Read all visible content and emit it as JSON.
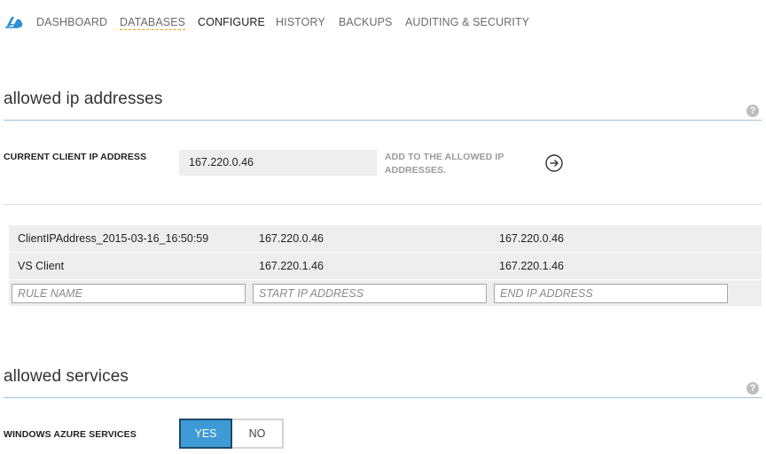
{
  "nav": {
    "logo_icon": "azure-cloud-icon",
    "tabs": [
      {
        "label": "DASHBOARD"
      },
      {
        "label": "DATABASES"
      },
      {
        "label": "CONFIGURE"
      },
      {
        "label": "HISTORY"
      },
      {
        "label": "BACKUPS"
      },
      {
        "label": "AUDITING & SECURITY"
      }
    ],
    "active_tab": "CONFIGURE"
  },
  "allowed_ip": {
    "title": "allowed ip addresses",
    "current_client_label": "CURRENT CLIENT IP ADDRESS",
    "current_client_value": "167.220.0.46",
    "add_action_label": "ADD TO THE ALLOWED IP ADDRESSES.",
    "add_icon": "circle-arrow-right-icon",
    "rules": [
      {
        "name": "ClientIPAddress_2015-03-16_16:50:59",
        "start": "167.220.0.46",
        "end": "167.220.0.46"
      },
      {
        "name": "VS Client",
        "start": "167.220.1.46",
        "end": "167.220.1.46"
      }
    ],
    "new_rule": {
      "name_placeholder": "RULE NAME",
      "start_placeholder": "START IP ADDRESS",
      "end_placeholder": "END IP ADDRESS"
    }
  },
  "allowed_services": {
    "title": "allowed services",
    "azure_label": "WINDOWS AZURE SERVICES",
    "yes_label": "YES",
    "no_label": "NO",
    "selected": "YES",
    "accent_color": "#3e9bd5"
  },
  "help_icon": "question-mark-icon",
  "colors": {
    "rule_line": "#9cc1dc",
    "row_background": "#eeeeee",
    "active_underline": "#e8a200"
  }
}
